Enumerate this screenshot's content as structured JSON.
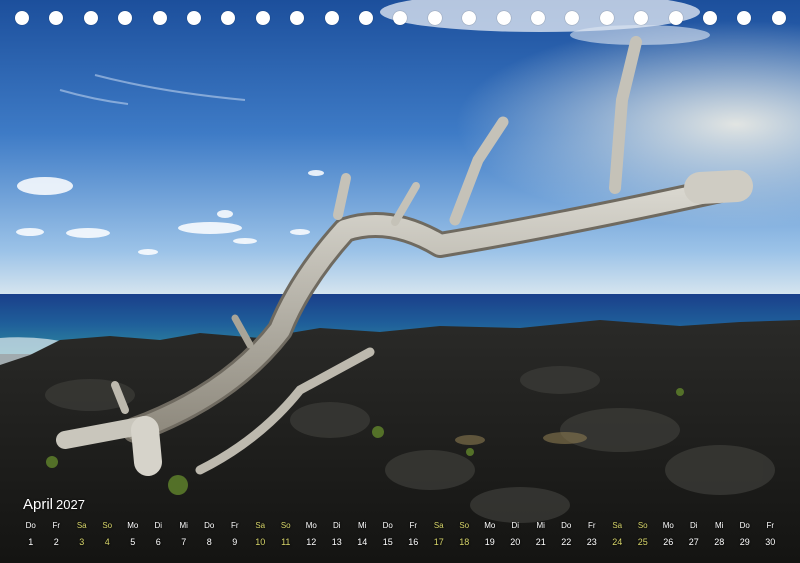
{
  "calendar": {
    "month": "April",
    "year": "2027",
    "weekend_color": "#d7d56a",
    "days": [
      {
        "wd": "Do",
        "n": "1",
        "we": false
      },
      {
        "wd": "Fr",
        "n": "2",
        "we": false
      },
      {
        "wd": "Sa",
        "n": "3",
        "we": true
      },
      {
        "wd": "So",
        "n": "4",
        "we": true
      },
      {
        "wd": "Mo",
        "n": "5",
        "we": false
      },
      {
        "wd": "Di",
        "n": "6",
        "we": false
      },
      {
        "wd": "Mi",
        "n": "7",
        "we": false
      },
      {
        "wd": "Do",
        "n": "8",
        "we": false
      },
      {
        "wd": "Fr",
        "n": "9",
        "we": false
      },
      {
        "wd": "Sa",
        "n": "10",
        "we": true
      },
      {
        "wd": "So",
        "n": "11",
        "we": true
      },
      {
        "wd": "Mo",
        "n": "12",
        "we": false
      },
      {
        "wd": "Di",
        "n": "13",
        "we": false
      },
      {
        "wd": "Mi",
        "n": "14",
        "we": false
      },
      {
        "wd": "Do",
        "n": "15",
        "we": false
      },
      {
        "wd": "Fr",
        "n": "16",
        "we": false
      },
      {
        "wd": "Sa",
        "n": "17",
        "we": true
      },
      {
        "wd": "So",
        "n": "18",
        "we": true
      },
      {
        "wd": "Mo",
        "n": "19",
        "we": false
      },
      {
        "wd": "Di",
        "n": "20",
        "we": false
      },
      {
        "wd": "Mi",
        "n": "21",
        "we": false
      },
      {
        "wd": "Do",
        "n": "22",
        "we": false
      },
      {
        "wd": "Fr",
        "n": "23",
        "we": false
      },
      {
        "wd": "Sa",
        "n": "24",
        "we": true
      },
      {
        "wd": "So",
        "n": "25",
        "we": true
      },
      {
        "wd": "Mo",
        "n": "26",
        "we": false
      },
      {
        "wd": "Di",
        "n": "27",
        "we": false
      },
      {
        "wd": "Mi",
        "n": "28",
        "we": false
      },
      {
        "wd": "Do",
        "n": "29",
        "we": false
      },
      {
        "wd": "Fr",
        "n": "30",
        "we": false
      }
    ]
  },
  "binding": {
    "hole_count": 23
  },
  "photo": {
    "subject": "driftwood-over-lava-coast"
  }
}
